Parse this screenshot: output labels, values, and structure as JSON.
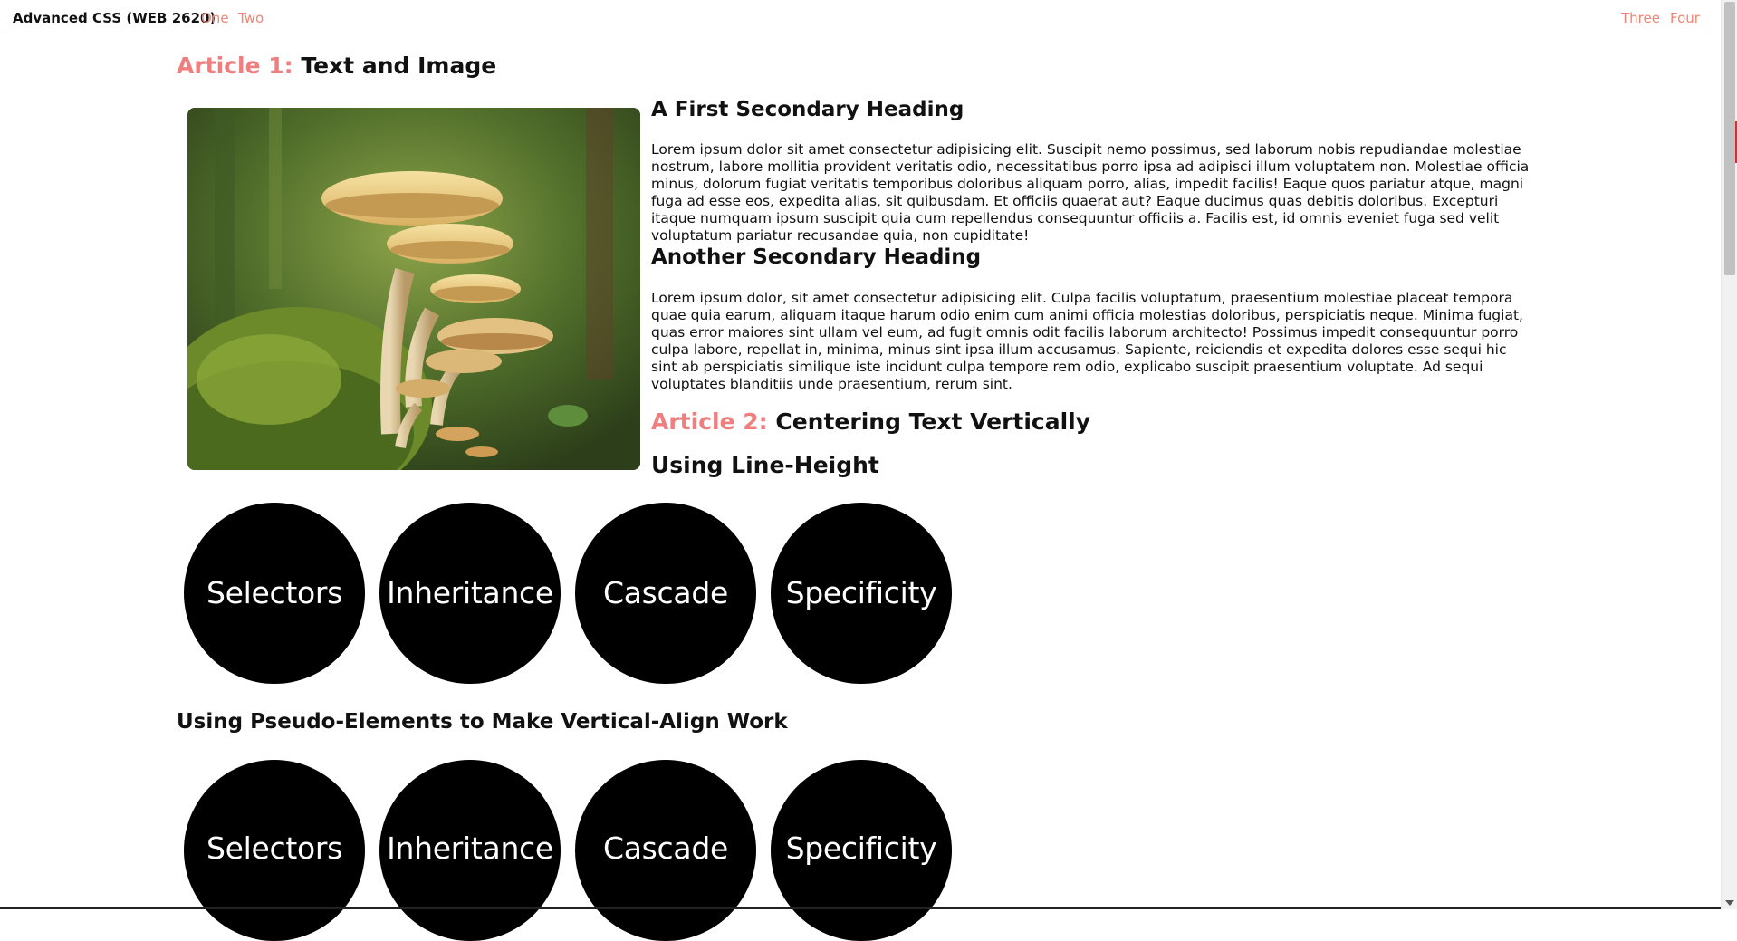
{
  "nav": {
    "brand": "Advanced CSS (WEB 2620)",
    "links_left": [
      "One",
      "Two"
    ],
    "links_right": [
      "Three",
      "Four"
    ],
    "link_color": "#f08573"
  },
  "article1": {
    "prefix": "Article 1:",
    "title": "Text and Image",
    "image_alt": "mushrooms-image",
    "headings": [
      "A First Secondary Heading",
      "Another Secondary Heading"
    ],
    "paragraphs": [
      "Lorem ipsum dolor sit amet consectetur adipisicing elit. Suscipit nemo possimus, sed laborum nobis repudiandae molestiae nostrum, labore mollitia provident veritatis odio, necessitatibus porro ipsa ad adipisci illum voluptatem non. Molestiae officia minus, dolorum fugiat veritatis temporibus doloribus aliquam porro, alias, impedit facilis! Eaque quos pariatur atque, magni fuga ad esse eos, expedita alias, sit quibusdam. Et officiis quaerat aut? Eaque ducimus quas debitis doloribus. Excepturi itaque numquam ipsum suscipit quia cum repellendus consequuntur officiis a. Facilis est, id omnis eveniet fuga sed velit voluptatum pariatur recusandae quia, non cupiditate!",
      "Lorem ipsum dolor, sit amet consectetur adipisicing elit. Culpa facilis voluptatum, praesentium molestiae placeat tempora quae quia earum, aliquam itaque harum odio enim cum animi officia molestias doloribus, perspiciatis neque. Minima fugiat, quas error maiores sint ullam vel eum, ad fugit omnis odit facilis laborum architecto! Possimus impedit consequuntur porro culpa labore, repellat in, minima, minus sint ipsa illum accusamus. Sapiente, reiciendis et expedita dolores esse sequi hic sint ab perspiciatis similique iste incidunt culpa tempore rem odio, explicabo suscipit praesentium voluptate. Ad sequi voluptates blanditiis unde praesentium, rerum sint."
    ]
  },
  "article2": {
    "prefix": "Article 2:",
    "title": "Centering Text Vertically",
    "line_height_heading": "Using Line-Height",
    "pseudo_heading": "Using Pseudo-Elements to Make Vertical-Align Work",
    "circles_row1": [
      "Selectors",
      "Inheritance",
      "Cascade",
      "Specificity"
    ],
    "circles_row2": [
      "Selectors",
      "Inheritance",
      "Cascade",
      "Specificity"
    ]
  },
  "colors": {
    "accent": "#f07e7e",
    "circle_bg": "#000000",
    "circle_text": "#ffffff"
  }
}
